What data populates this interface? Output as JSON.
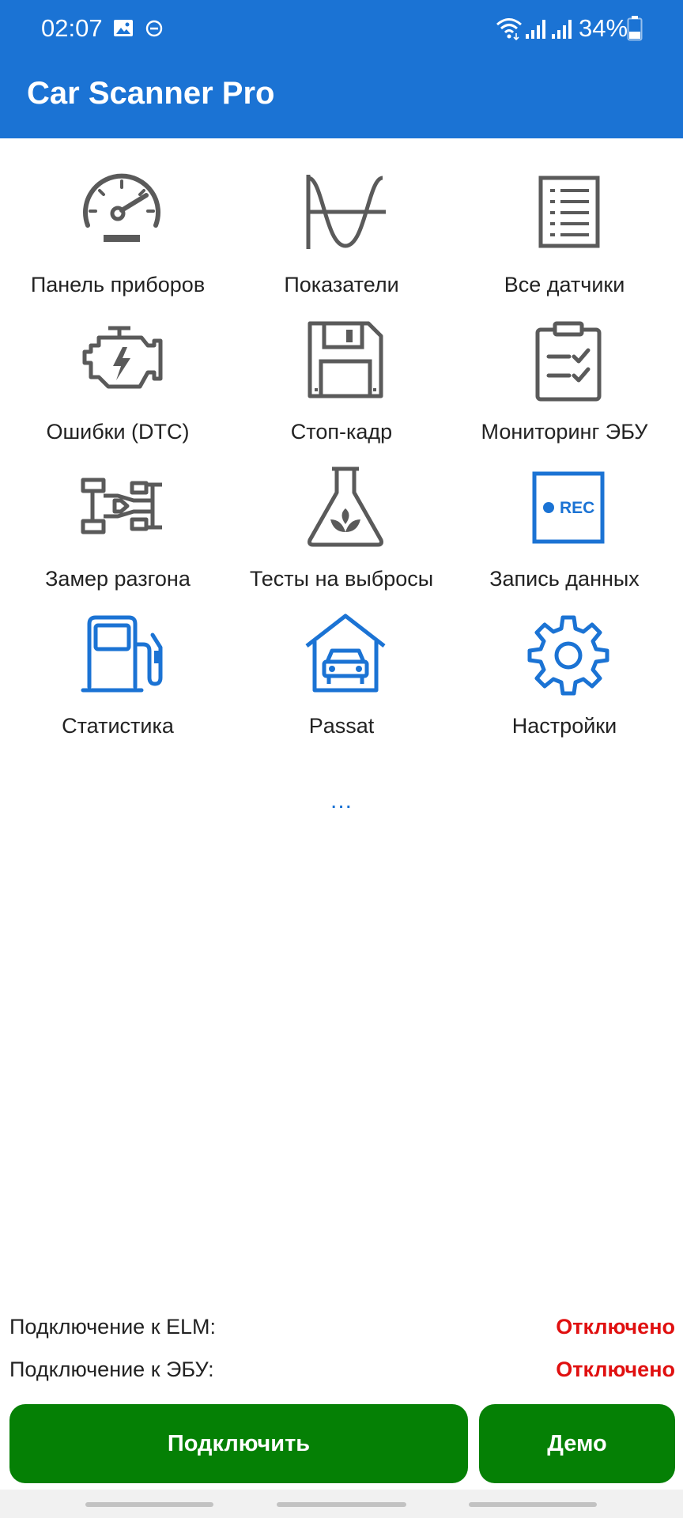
{
  "status_bar": {
    "time": "02:07",
    "battery_percent": "34%",
    "icons": [
      "gallery-icon",
      "do-not-disturb-icon",
      "wifi-icon",
      "signal-icon",
      "signal-icon",
      "battery-icon"
    ]
  },
  "app": {
    "title": "Car Scanner Pro"
  },
  "colors": {
    "header": "#1b73d4",
    "accent": "#1b73d4",
    "icon_gray": "#5a5a5a",
    "button_green": "#058005",
    "status_red": "#e01010"
  },
  "menu": {
    "items": [
      {
        "label": "Панель приборов",
        "icon": "speedometer-icon"
      },
      {
        "label": "Показатели",
        "icon": "sine-wave-icon"
      },
      {
        "label": "Все датчики",
        "icon": "list-icon"
      },
      {
        "label": "Ошибки (DTC)",
        "icon": "engine-icon"
      },
      {
        "label": "Стоп-кадр",
        "icon": "floppy-disk-icon"
      },
      {
        "label": "Мониторинг ЭБУ",
        "icon": "clipboard-check-icon"
      },
      {
        "label": "Замер разгона",
        "icon": "race-car-icon"
      },
      {
        "label": "Тесты на выбросы",
        "icon": "flask-leaf-icon"
      },
      {
        "label": "Запись данных",
        "icon": "rec-icon",
        "icon_text": "REC"
      },
      {
        "label": "Статистика",
        "icon": "fuel-pump-icon"
      },
      {
        "label": "Passat",
        "icon": "garage-car-icon"
      },
      {
        "label": "Настройки",
        "icon": "gear-icon"
      }
    ],
    "more": "..."
  },
  "connection": {
    "elm_label": "Подключение к ELM:",
    "elm_status": "Отключено",
    "ecu_label": "Подключение к ЭБУ:",
    "ecu_status": "Отключено"
  },
  "buttons": {
    "connect": "Подключить",
    "demo": "Демо"
  }
}
